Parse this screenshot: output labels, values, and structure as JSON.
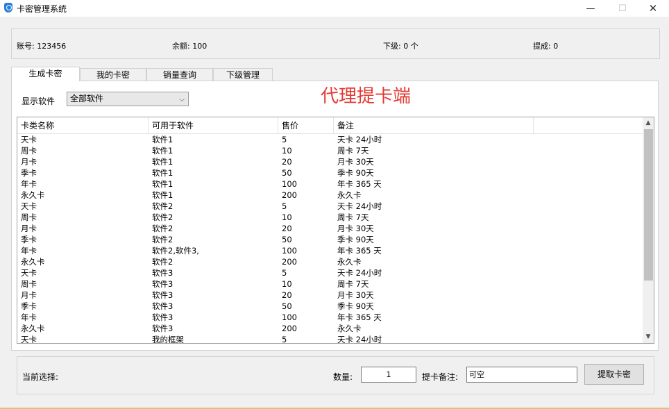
{
  "window": {
    "title": "卡密管理系统",
    "min_glyph": "—",
    "max_glyph": "☐",
    "close_glyph": "✕"
  },
  "info": {
    "account": "账号: 123456",
    "balance": "余额: 100",
    "subordinate": "下级: 0 个",
    "commission": "提成: 0"
  },
  "tabs": [
    {
      "label": "生成卡密",
      "active": true
    },
    {
      "label": "我的卡密",
      "active": false
    },
    {
      "label": "销量查询",
      "active": false
    },
    {
      "label": "下级管理",
      "active": false
    }
  ],
  "filter": {
    "label": "显示软件",
    "selected": "全部软件"
  },
  "watermark": "代理提卡端",
  "table": {
    "headers": [
      "卡类名称",
      "可用于软件",
      "售价",
      "备注"
    ],
    "rows": [
      [
        "天卡",
        "软件1",
        "5",
        "天卡 24小时"
      ],
      [
        "周卡",
        "软件1",
        "10",
        "周卡 7天"
      ],
      [
        "月卡",
        "软件1",
        "20",
        "月卡 30天"
      ],
      [
        "季卡",
        "软件1",
        "50",
        "季卡 90天"
      ],
      [
        "年卡",
        "软件1",
        "100",
        "年卡 365 天"
      ],
      [
        "永久卡",
        "软件1",
        "200",
        "永久卡"
      ],
      [
        "天卡",
        "软件2",
        "5",
        "天卡 24小时"
      ],
      [
        "周卡",
        "软件2",
        "10",
        "周卡 7天"
      ],
      [
        "月卡",
        "软件2",
        "20",
        "月卡 30天"
      ],
      [
        "季卡",
        "软件2",
        "50",
        "季卡 90天"
      ],
      [
        "年卡",
        "软件2,软件3,",
        "100",
        "年卡 365 天"
      ],
      [
        "永久卡",
        "软件2",
        "200",
        "永久卡"
      ],
      [
        "天卡",
        "软件3",
        "5",
        "天卡 24小时"
      ],
      [
        "周卡",
        "软件3",
        "10",
        "周卡 7天"
      ],
      [
        "月卡",
        "软件3",
        "20",
        "月卡 30天"
      ],
      [
        "季卡",
        "软件3",
        "50",
        "季卡 90天"
      ],
      [
        "年卡",
        "软件3",
        "100",
        "年卡 365 天"
      ],
      [
        "永久卡",
        "软件3",
        "200",
        "永久卡"
      ],
      [
        "天卡",
        "我的框架",
        "5",
        "天卡 24小时"
      ]
    ]
  },
  "bottom": {
    "current_selection_label": "当前选择:",
    "quantity_label": "数量:",
    "quantity_value": "1",
    "note_label": "提卡备注:",
    "note_placeholder": "可空",
    "extract_button": "提取卡密"
  }
}
